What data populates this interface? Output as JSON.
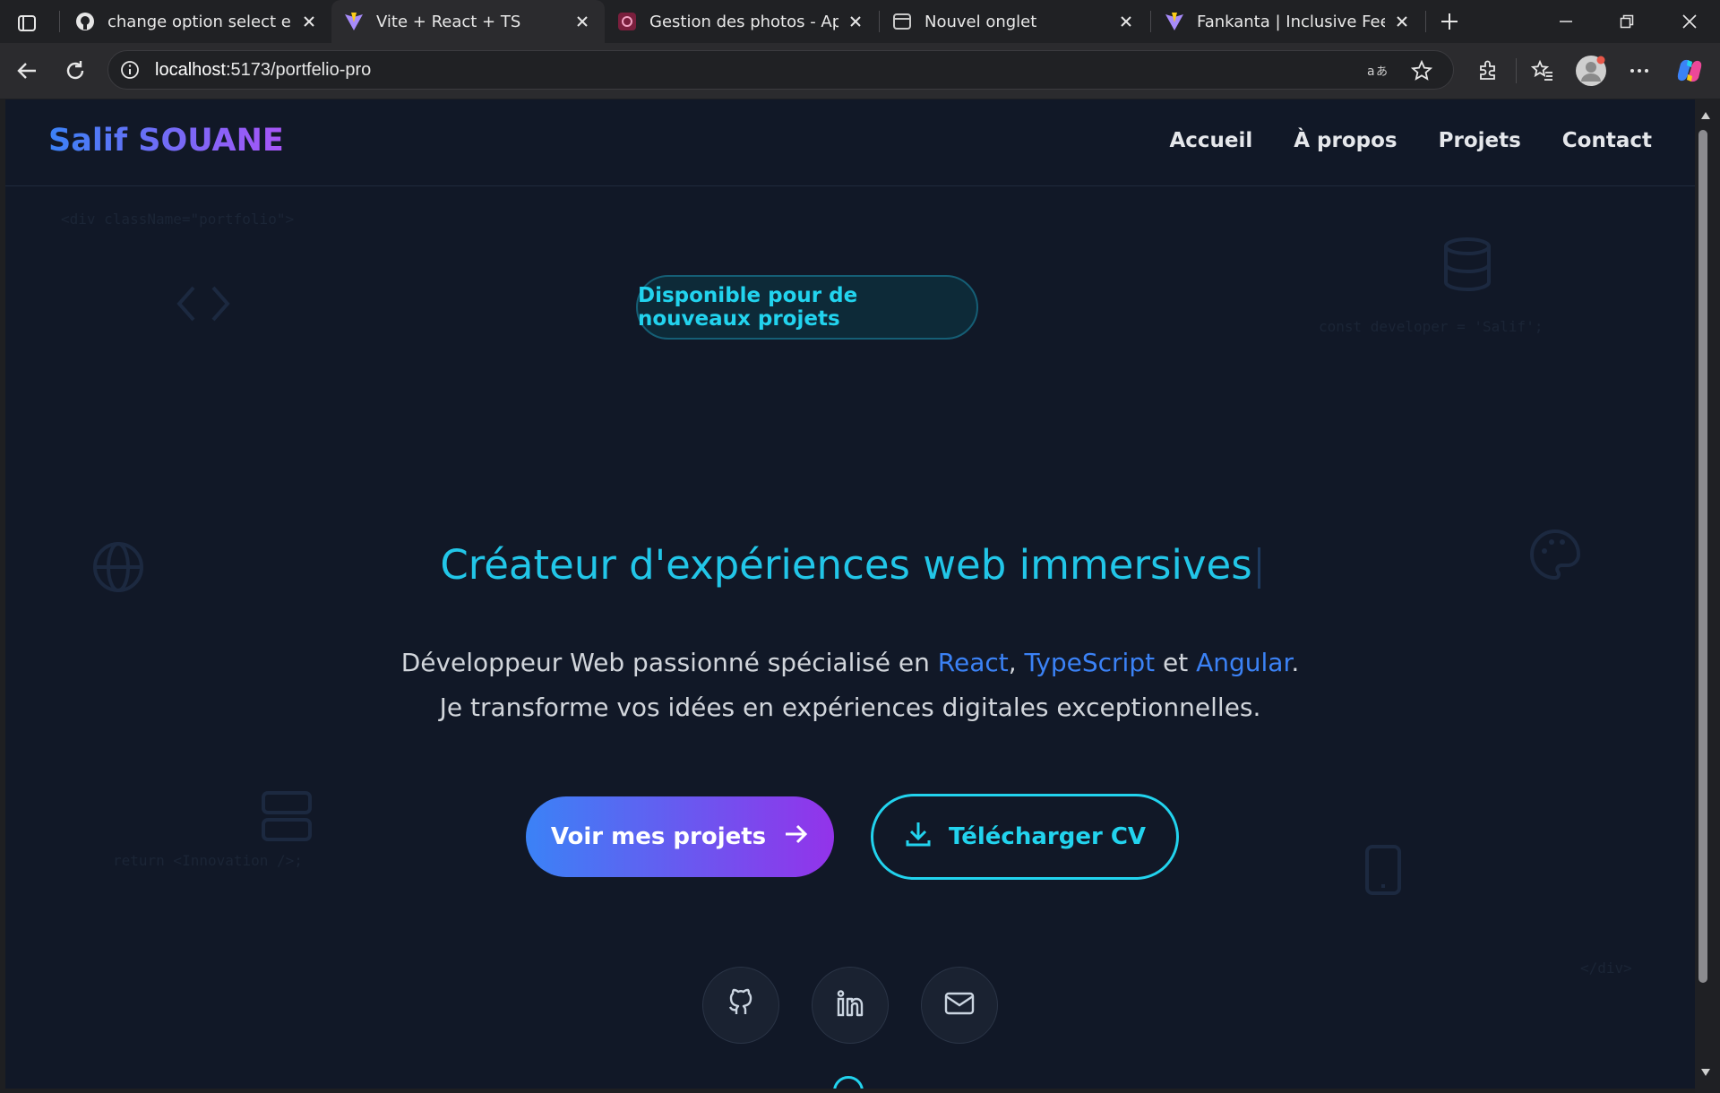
{
  "browser": {
    "tabs": [
      {
        "title": "change option select en rad",
        "icon": "github-icon",
        "active": false
      },
      {
        "title": "Vite + React + TS",
        "icon": "vite-icon",
        "active": true
      },
      {
        "title": "Gestion des photos - Appli",
        "icon": "photos-app-icon",
        "active": false
      },
      {
        "title": "Nouvel onglet",
        "icon": "new-tab-page-icon",
        "active": false
      },
      {
        "title": "Fankanta | Inclusive Feedba",
        "icon": "vite-icon",
        "active": false
      }
    ],
    "address": {
      "host": "localhost",
      "path": ":5173/portfelio-pro"
    }
  },
  "page": {
    "brand": "Salif SOUANE",
    "nav": [
      "Accueil",
      "À propos",
      "Projets",
      "Contact"
    ],
    "bg_code": {
      "top_left": "<div className=\"portfolio\">",
      "top_right": "const developer = 'Salif';",
      "bottom_left": "return <Innovation />;",
      "bottom_right": "</div>"
    },
    "badge": "Disponible pour de nouveaux projets",
    "headline": "Créateur d'expériences web immersives",
    "subtitle": {
      "line1_prefix": "Développeur Web passionné spécialisé en ",
      "tech1": "React",
      "sep1": ", ",
      "tech2": "TypeScript",
      "sep2": " et ",
      "tech3": "Angular",
      "end": ".",
      "line2": "Je transforme vos idées en expériences digitales exceptionnelles."
    },
    "cta_primary": "Voir mes projets",
    "cta_secondary": "Télécharger CV",
    "socials": [
      "github-icon",
      "linkedin-icon",
      "mail-icon"
    ],
    "colors": {
      "accent_cyan": "#22d3ee",
      "accent_blue": "#3b82f6",
      "accent_purple": "#9333ea",
      "page_bg": "#111827"
    }
  }
}
